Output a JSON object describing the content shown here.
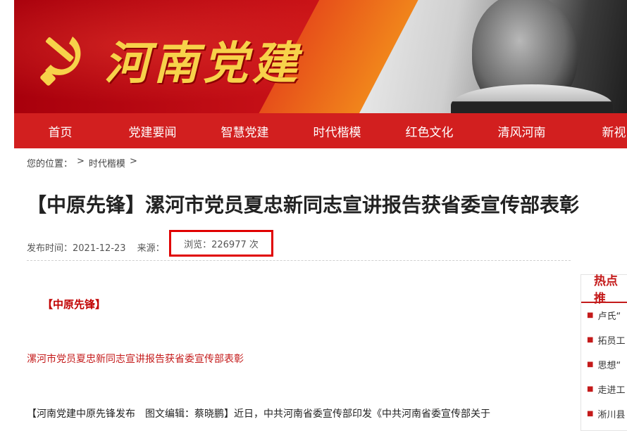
{
  "header": {
    "logo_text": "河南党建"
  },
  "nav": {
    "items": [
      "首页",
      "党建要闻",
      "智慧党建",
      "时代楷模",
      "红色文化",
      "清风河南",
      "新视"
    ]
  },
  "breadcrumb": {
    "label": "您的位置：",
    "sep": ">",
    "current": "时代楷模"
  },
  "article": {
    "title": "【中原先锋】漯河市党员夏忠新同志宣讲报告获省委宣传部表彰",
    "publish_time": "发布时间：2021-12-23",
    "source": "来源：",
    "views": "浏览：226977 次",
    "tag": "【中原先锋】",
    "subtitle": "漯河市党员夏忠新同志宣讲报告获省委宣传部表彰",
    "paragraph": "【河南党建中原先锋发布　图文编辑：蔡晓鹏】近日，中共河南省委宣传部印发《中共河南省委宣传部关于"
  },
  "sidebar": {
    "heading": "热点推",
    "items": [
      "卢氏“",
      "拓员工",
      "思想“",
      "走进工",
      "淅川县"
    ]
  },
  "colors": {
    "brand_red": "#d21f1f",
    "highlight_box": "#e00000",
    "logo_gold": "#f7d24a"
  }
}
